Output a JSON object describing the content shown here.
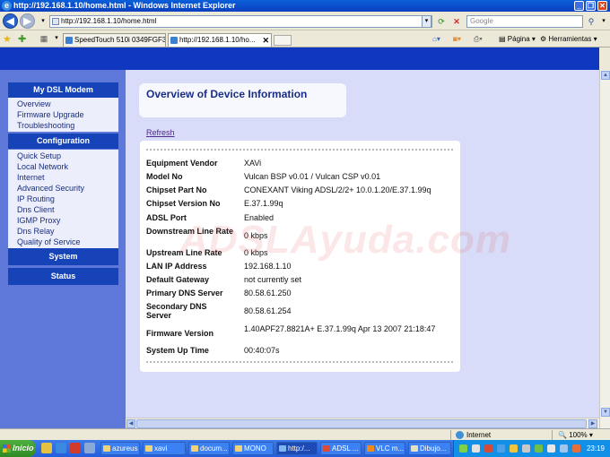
{
  "window": {
    "title": "http://192.168.1.10/home.html - Windows Internet Explorer",
    "minimize": "_",
    "maximize": "❐",
    "close": "✕"
  },
  "addressbar": {
    "url": "http://192.168.1.10/home.html",
    "search_placeholder": "Google"
  },
  "tabs": [
    {
      "label": "SpeedTouch 510i  0349FGF3G"
    },
    {
      "label": "http://192.168.1.10/ho..."
    }
  ],
  "commands": {
    "page": "Página",
    "tools": "Herramientas"
  },
  "sidebar": {
    "my_dsl_modem": {
      "header": "My DSL Modem",
      "items": [
        "Overview",
        "Firmware Upgrade",
        "Troubleshooting"
      ]
    },
    "configuration": {
      "header": "Configuration",
      "items": [
        "Quick Setup",
        "Local Network",
        "Internet",
        "Advanced Security",
        "IP Routing",
        "Dns Client",
        "IGMP Proxy",
        "Dns Relay",
        "Quality of Service"
      ]
    },
    "system": {
      "header": "System"
    },
    "status": {
      "header": "Status"
    }
  },
  "content": {
    "title": "Overview of Device Information",
    "refresh": "Refresh",
    "rows": [
      {
        "label": "Equipment Vendor",
        "value": "XAVi"
      },
      {
        "label": "Model No",
        "value": "Vulcan BSP v0.01 / Vulcan CSP v0.01"
      },
      {
        "label": "Chipset Part No",
        "value": "CONEXANT Viking ADSL/2/2+ 10.0.1.20/E.37.1.99q"
      },
      {
        "label": "Chipset Version No",
        "value": "E.37.1.99q"
      },
      {
        "label": "ADSL Port",
        "value": "Enabled"
      },
      {
        "label": "Downstream Line Rate",
        "value": "0 kbps"
      },
      {
        "label": "Upstream Line Rate",
        "value": "0 kbps"
      },
      {
        "label": "LAN IP Address",
        "value": "192.168.1.10"
      },
      {
        "label": "Default Gateway",
        "value": "not currently set"
      },
      {
        "label": "Primary DNS Server",
        "value": "80.58.61.250"
      },
      {
        "label": "Secondary DNS Server",
        "value": "80.58.61.254"
      },
      {
        "label": "Firmware Version",
        "value": "1.40APF27.8821A+ E.37.1.99q Apr 13 2007 21:18:47"
      },
      {
        "label": "System Up Time",
        "value": "00:40:07s"
      }
    ]
  },
  "watermark": "ADSLAyuda.com",
  "statusbar": {
    "zone": "Internet",
    "zoom": "100%"
  },
  "taskbar": {
    "start": "Inicio",
    "items": [
      "azureus",
      "xavi",
      "docum...",
      "MONO",
      "http:/...",
      "ADSL ...",
      "VLC m...",
      "Dibujo..."
    ],
    "clock": "23:19"
  }
}
